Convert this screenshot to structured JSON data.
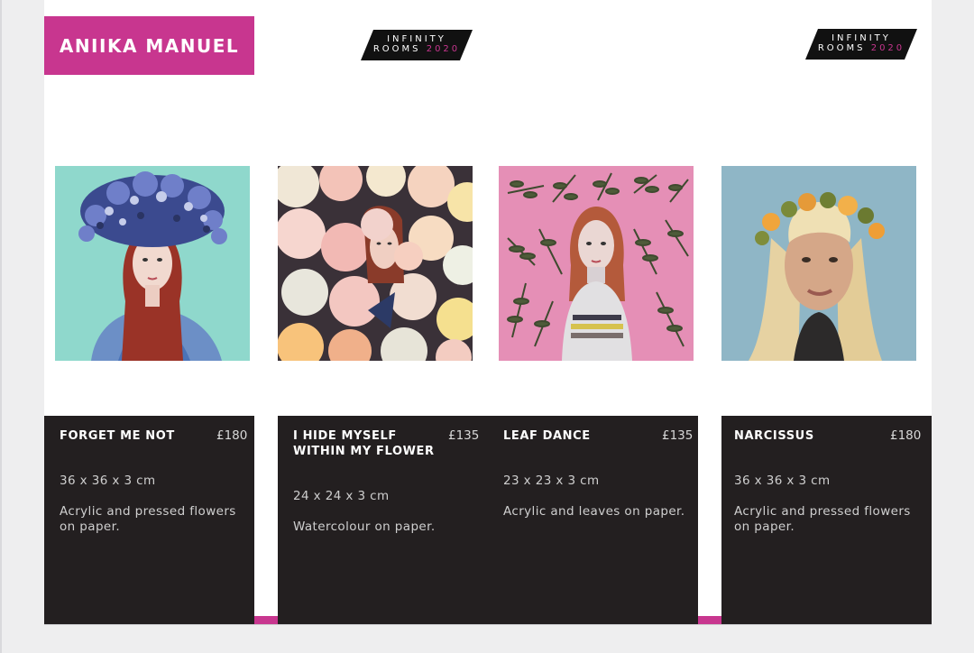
{
  "header": {
    "artist_name": "ANIIKA MANUEL",
    "logo": {
      "line1": "INFINITY",
      "line2_text": "ROOMS",
      "line2_year": "2020"
    }
  },
  "colors": {
    "accent": "#c8368f",
    "card_bg": "#231f20",
    "page_bg": "#ffffff"
  },
  "artworks": [
    {
      "title": "FORGET ME NOT",
      "price": "£180",
      "dimensions": "36 x 36 x 3 cm",
      "medium": "Acrylic and pressed flowers on paper."
    },
    {
      "title": "I HIDE MYSELF WITHIN MY FLOWER",
      "price": "£135",
      "dimensions": "24 x 24 x 3 cm",
      "medium": "Watercolour on paper."
    },
    {
      "title": "LEAF DANCE",
      "price": "£135",
      "dimensions": "23 x 23 x 3 cm",
      "medium": "Acrylic and leaves on paper."
    },
    {
      "title": "NARCISSUS",
      "price": "£180",
      "dimensions": "36 x 36 x 3 cm",
      "medium": "Acrylic and pressed flowers on paper."
    }
  ]
}
